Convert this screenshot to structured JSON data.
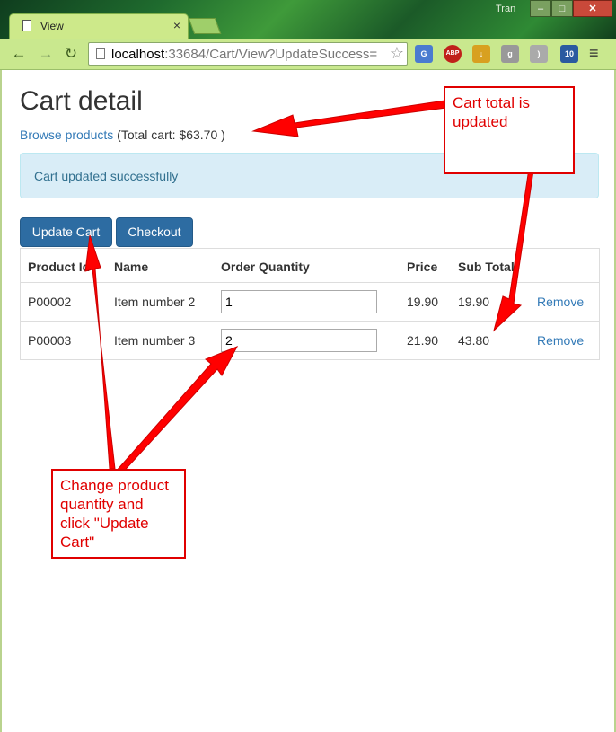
{
  "browser": {
    "tab_title": "View",
    "tab_close": "×",
    "user": "Tran",
    "window_buttons": {
      "minimize": "‒",
      "maximize": "□",
      "close": "✕"
    },
    "nav": {
      "back": "←",
      "forward": "→",
      "reload": "↻"
    },
    "url_host": "localhost",
    "url_rest": ":33684/Cart/View?UpdateSuccess=",
    "star": "☆",
    "extensions": [
      {
        "name": "translate-icon",
        "label": "G"
      },
      {
        "name": "adblock-icon",
        "label": "ABP"
      },
      {
        "name": "download-icon",
        "label": "↓"
      },
      {
        "name": "google-icon",
        "label": "g"
      },
      {
        "name": "rss-icon",
        "label": ")"
      },
      {
        "name": "badge-icon",
        "label": "10"
      }
    ],
    "menu": "≡"
  },
  "page": {
    "title": "Cart detail",
    "browse_link": "Browse products",
    "total_text": "(Total cart: $63.70 )",
    "alert": "Cart updated successfully",
    "buttons": {
      "update": "Update Cart",
      "checkout": "Checkout"
    },
    "table": {
      "headers": [
        "Product Id",
        "Name",
        "Order Quantity",
        "Price",
        "Sub Total",
        ""
      ],
      "rows": [
        {
          "id": "P00002",
          "name": "Item number 2",
          "qty": "1",
          "price": "19.90",
          "subtotal": "19.90",
          "action": "Remove"
        },
        {
          "id": "P00003",
          "name": "Item number 3",
          "qty": "2",
          "price": "21.90",
          "subtotal": "43.80",
          "action": "Remove"
        }
      ]
    }
  },
  "annotations": {
    "total": "Cart total is updated",
    "quantity": "Change product quantity and click \"Update Cart\"",
    "color": "#e00000"
  }
}
